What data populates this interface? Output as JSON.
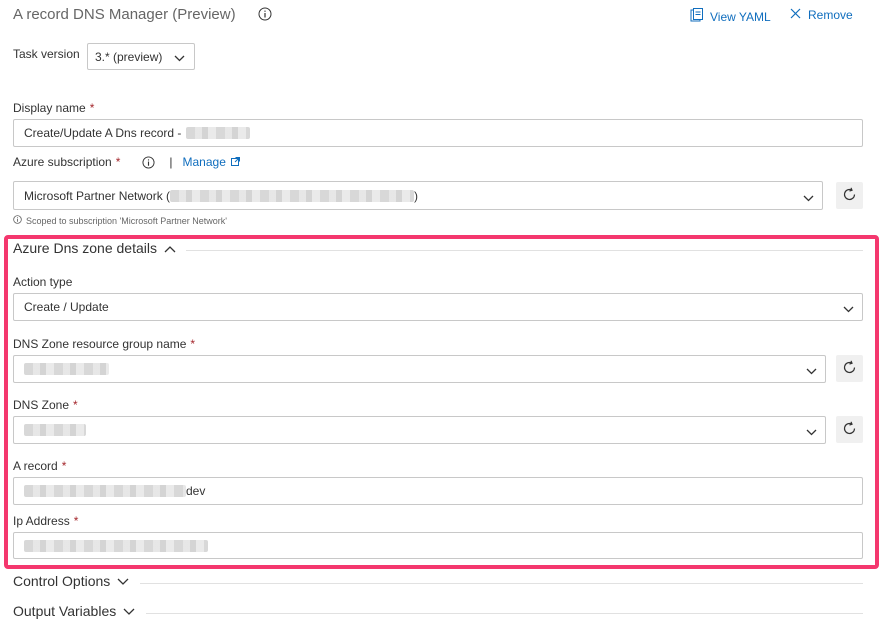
{
  "header": {
    "title": "A record DNS Manager (Preview)",
    "view_yaml": "View YAML",
    "remove": "Remove"
  },
  "task_version": {
    "label": "Task version",
    "value": "3.* (preview)"
  },
  "display_name": {
    "label": "Display name",
    "required": "*",
    "value": "Create/Update A Dns record -"
  },
  "azure_subscription": {
    "label": "Azure subscription",
    "required": "*",
    "separator": "|",
    "manage": "Manage",
    "value_prefix": "Microsoft Partner Network (",
    "value_suffix": ")",
    "scoped_note": "Scoped to subscription 'Microsoft Partner Network'"
  },
  "dns_zone_section": {
    "title": "Azure Dns zone details",
    "action_type": {
      "label": "Action type",
      "value": "Create / Update"
    },
    "resource_group": {
      "label": "DNS Zone resource group name",
      "required": "*"
    },
    "dns_zone": {
      "label": "DNS Zone",
      "required": "*"
    },
    "a_record": {
      "label": "A record",
      "required": "*",
      "value_suffix": "dev"
    },
    "ip_address": {
      "label": "Ip Address",
      "required": "*"
    }
  },
  "collapsed_sections": {
    "control_options": "Control Options",
    "output_variables": "Output Variables"
  },
  "colors": {
    "accent": "#106ebe",
    "required": "#a4262c",
    "highlight": "#f4376e"
  }
}
